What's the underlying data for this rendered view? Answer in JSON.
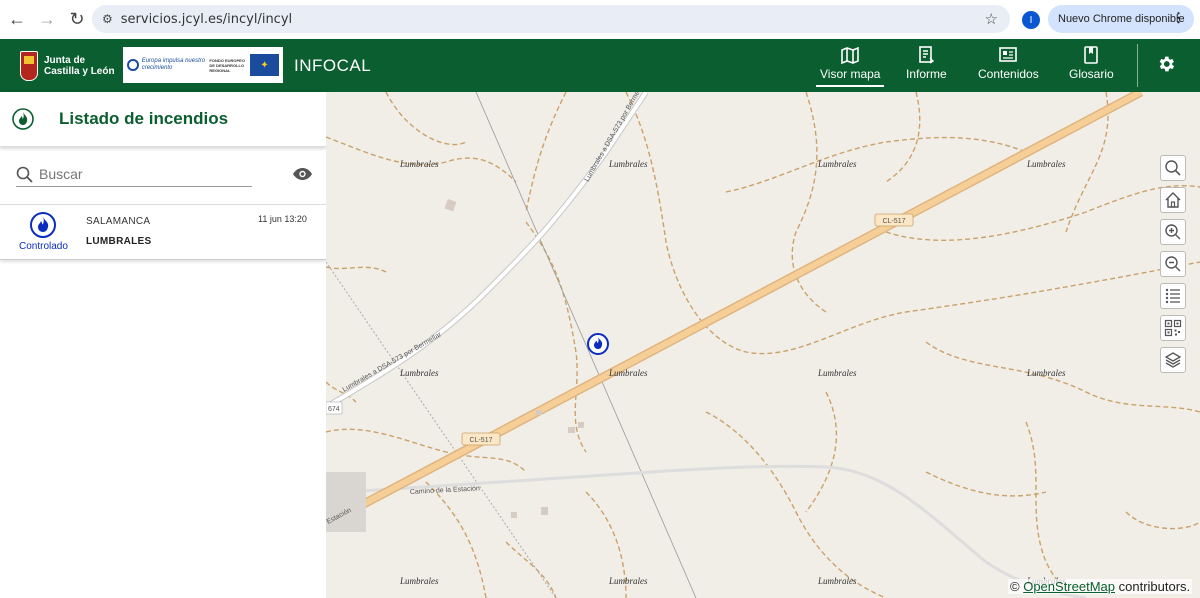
{
  "browser": {
    "url": "servicios.jcyl.es/incyl/incyl",
    "profile_initial": "I",
    "update_label": "Nuevo Chrome disponible"
  },
  "header": {
    "logo_text_line1": "Junta de",
    "logo_text_line2": "Castilla y León",
    "eu_text": "Europa impulsa nuestro crecimiento",
    "eu_fund": "FONDO EUROPEO DE DESARROLLO REGIONAL",
    "eu_union": "UNIÓN EUROPEA",
    "title": "INFOCAL",
    "nav": [
      {
        "label": "Visor mapa",
        "icon": "map-icon",
        "active": true
      },
      {
        "label": "Informe",
        "icon": "report-icon",
        "active": false
      },
      {
        "label": "Contenidos",
        "icon": "content-icon",
        "active": false
      },
      {
        "label": "Glosario",
        "icon": "book-icon",
        "active": false
      }
    ]
  },
  "panel": {
    "title": "Listado de incendios",
    "search_placeholder": "Buscar",
    "items": [
      {
        "province": "SALAMANCA",
        "municipality": "LUMBRALES",
        "date": "11 jun 13:20",
        "status": "Controlado"
      }
    ]
  },
  "map": {
    "places": [
      "Lumbrales",
      "Lumbrales",
      "Lumbrales",
      "Lumbrales",
      "Lumbrales",
      "Lumbrales",
      "Lumbrales",
      "Lumbrales",
      "Lumbrales",
      "Lumbrales",
      "Lumbrales",
      "Lumbrales"
    ],
    "road_main": "CL-517",
    "road_secondary": "Lumbrales a DSA-573 por Bermellar",
    "road_path": "Camino de la Estación",
    "road_stub": "674",
    "road_estacion": "Estación",
    "attribution_prefix": "©",
    "attribution_link": "OpenStreetMap",
    "attribution_suffix": "contributors.",
    "tools": [
      "search-icon",
      "home-icon",
      "zoom-in-icon",
      "zoom-out-icon",
      "legend-icon",
      "qr-icon",
      "layers-icon"
    ]
  }
}
